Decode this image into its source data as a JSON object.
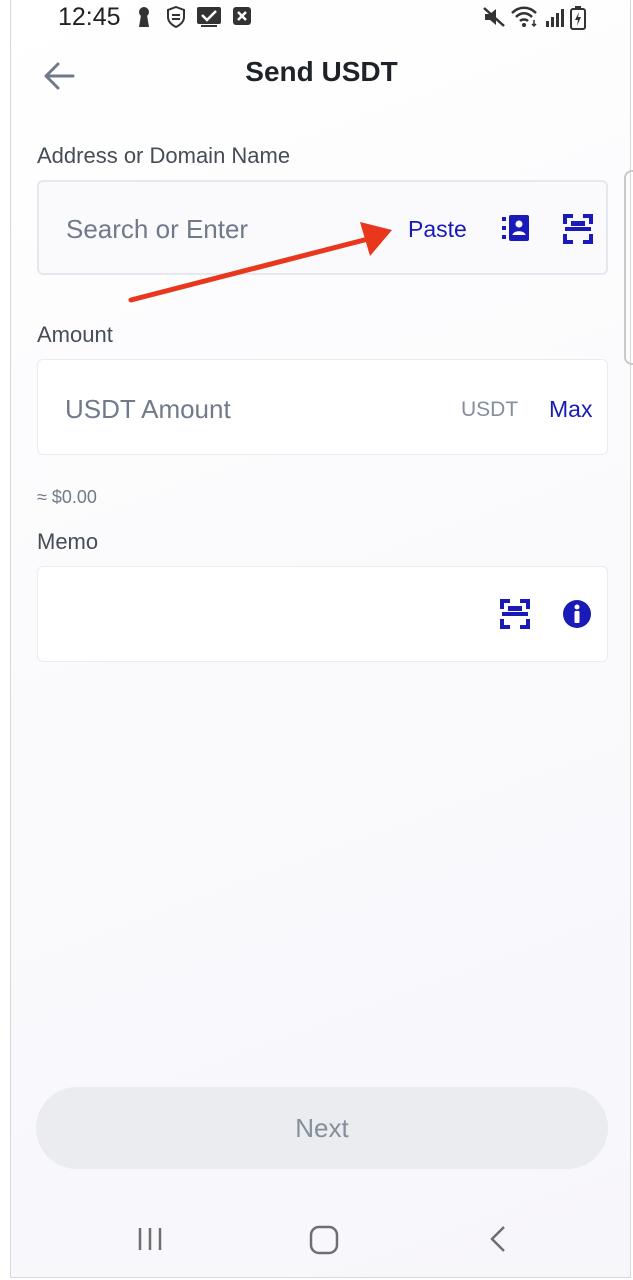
{
  "status_bar": {
    "time": "12:45",
    "left_icons": [
      "keyhole-icon",
      "vpn-shield-icon",
      "checkmark-message-icon",
      "close-box-icon"
    ],
    "right_icons": [
      "mute-icon",
      "wifi-icon",
      "signal-icon",
      "battery-charging-icon"
    ]
  },
  "header": {
    "title": "Send USDT",
    "back_icon": "arrow-left-icon"
  },
  "address": {
    "label": "Address or Domain Name",
    "placeholder": "Search or Enter",
    "paste_label": "Paste",
    "address_book_icon": "address-book-icon",
    "scan_icon": "scan-qr-icon"
  },
  "amount": {
    "label": "Amount",
    "placeholder": "USDT Amount",
    "unit": "USDT",
    "max_label": "Max",
    "approx_value": "≈ $0.00"
  },
  "memo": {
    "label": "Memo",
    "scan_icon": "scan-qr-icon",
    "info_icon": "info-icon"
  },
  "footer": {
    "next_label": "Next"
  },
  "nav_bar": {
    "icons": [
      "recent-apps-icon",
      "home-icon",
      "back-icon"
    ]
  },
  "colors": {
    "accent": "#1a1ab8",
    "annotation_arrow": "#e8371c",
    "button_bg": "#eaecef"
  }
}
